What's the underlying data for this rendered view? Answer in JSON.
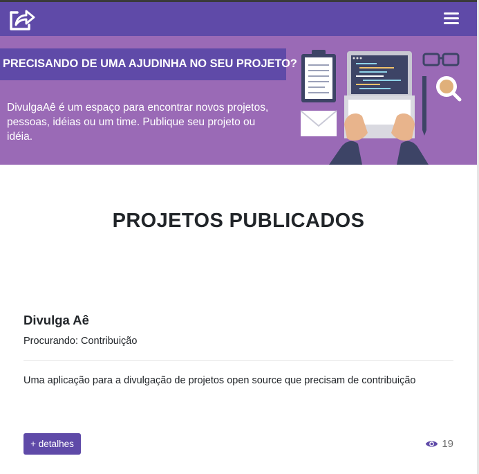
{
  "navbar": {
    "brand_icon": "share-arrow-icon",
    "menu_icon": "hamburger-icon",
    "background": "#5f4aa8"
  },
  "hero": {
    "title": "PRECISANDO DE UMA AJUDINHA NO SEU PROJETO?",
    "description": "DivulgaAê é um espaço para encontrar novos projetos, pessoas, idéias ou um time. Publique seu projeto ou idéia.",
    "background": "#9a6ab6",
    "illustration": "laptop-workspace-illustration"
  },
  "main": {
    "title": "PROJETOS PUBLICADOS"
  },
  "projects": [
    {
      "name": "Divulga Aê",
      "looking_for": "Procurando: Contribuição",
      "description": "Uma aplicação para a divulgação de projetos open source que precisam de contribuição",
      "details_label": "+ detalhes",
      "views_icon": "eye-icon",
      "views": "19"
    }
  ]
}
